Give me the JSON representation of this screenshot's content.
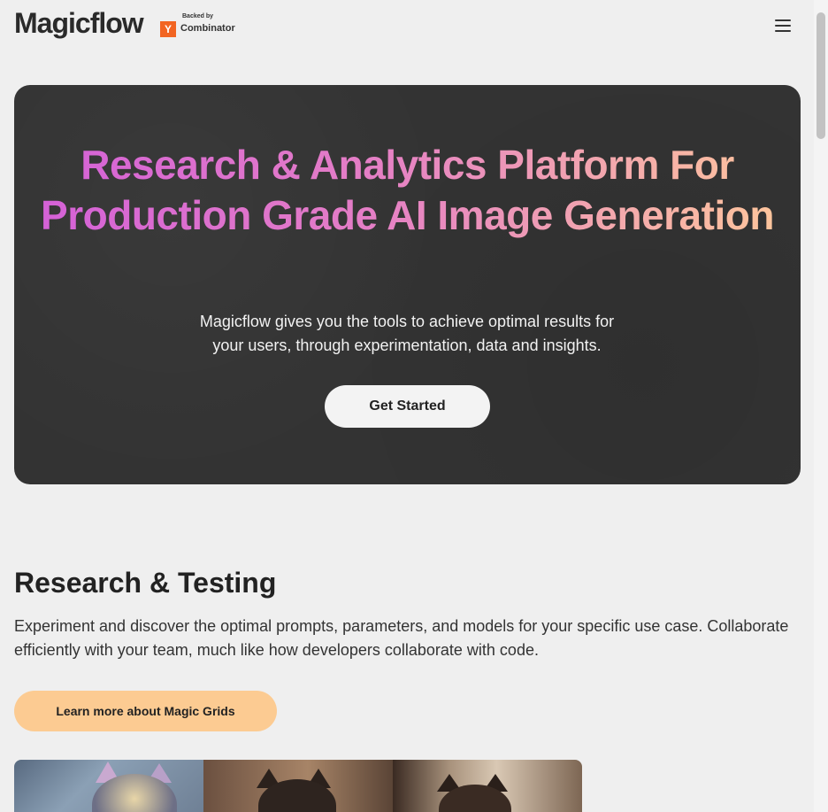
{
  "header": {
    "logo_text": "Magicflow",
    "badge": {
      "backed_by": "Backed by",
      "mark": "Y",
      "name": "Combinator",
      "mark_color": "#f26522"
    },
    "menu_icon": "hamburger-menu-icon"
  },
  "hero": {
    "title": "Research & Analytics Platform For Production Grade AI Image Generation",
    "subtitle": "Magicflow gives you the tools to achieve optimal results for your users, through experimentation, data and insights.",
    "cta_label": "Get Started",
    "gradient_colors": [
      "#d35fd8",
      "#e47ec6",
      "#ffc99a"
    ],
    "background_color": "#333333"
  },
  "research": {
    "title": "Research & Testing",
    "description": "Experiment and discover the optimal prompts, parameters, and models for your specific use case. Collaborate efficiently with your team, much like how developers collaborate with code.",
    "cta_label": "Learn more about Magic Grids",
    "cta_color": "#fccb92"
  },
  "image_grid": {
    "images": [
      "tabby-kitten-image",
      "dark-kitten-image",
      "brown-kitten-image"
    ]
  }
}
